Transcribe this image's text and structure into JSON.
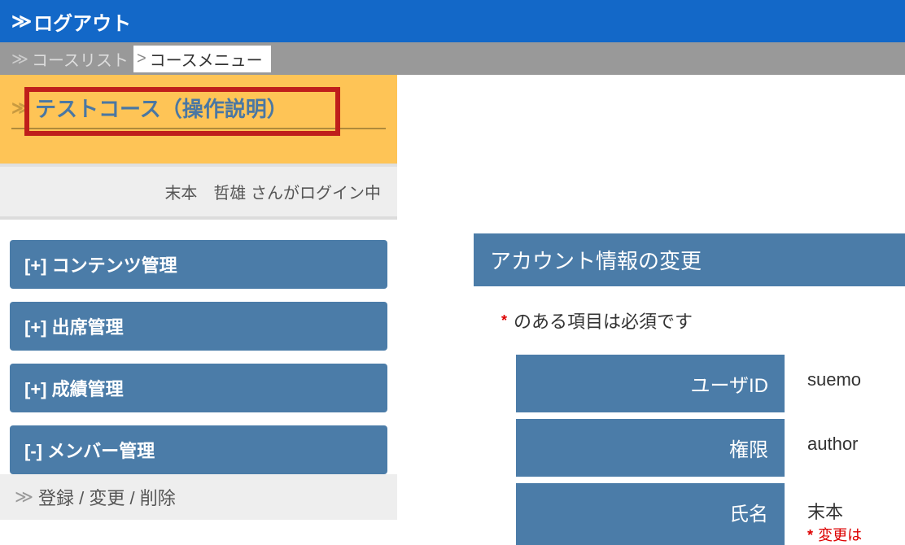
{
  "topbar": {
    "logout": "ログアウト"
  },
  "breadcrumb": {
    "course_list": "コースリスト",
    "course_menu": "コースメニュー"
  },
  "course": {
    "title": "テストコース（操作説明）"
  },
  "login_status": "末本　哲雄 さんがログイン中",
  "menu": {
    "content": "[+] コンテンツ管理",
    "attendance": "[+] 出席管理",
    "grades": "[+] 成績管理",
    "members": "[-] メンバー管理",
    "members_sub": "登録 / 変更 / 削除"
  },
  "panel": {
    "title": "アカウント情報の変更",
    "required_note": "のある項目は必須です",
    "rows": {
      "user_id": {
        "label": "ユーザID",
        "value": "suemo"
      },
      "role": {
        "label": "権限",
        "value": "author"
      },
      "name": {
        "label": "氏名",
        "value": "末本",
        "change_note": "変更は"
      }
    }
  }
}
